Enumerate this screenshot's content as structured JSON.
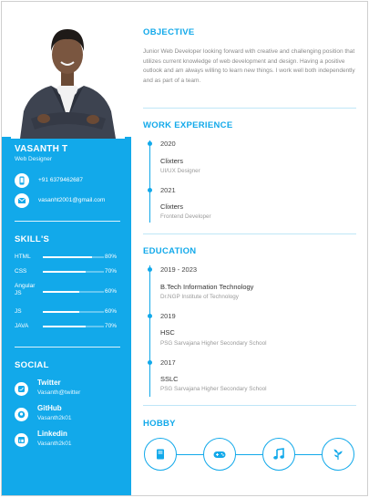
{
  "profile": {
    "name": "VASANTH T",
    "title": "Web Designer",
    "phone": "+91 6379462687",
    "email": "vasanht2001@gmail.com"
  },
  "skills_heading": "SKILL'S",
  "skills": [
    {
      "name": "HTML",
      "percent_label": "80%",
      "level": 0.8
    },
    {
      "name": "CSS",
      "percent_label": "70%",
      "level": 0.7
    },
    {
      "name": "Angular JS",
      "percent_label": "60%",
      "level": 0.6
    },
    {
      "name": "JS",
      "percent_label": "60%",
      "level": 0.6
    },
    {
      "name": "JAVA",
      "percent_label": "70%",
      "level": 0.7
    }
  ],
  "social_heading": "SOCIAL",
  "social": [
    {
      "network": "Twitter",
      "handle": "Vasanth@twitter",
      "icon": "twitter-icon"
    },
    {
      "network": "GitHub",
      "handle": "Vasanth2k01",
      "icon": "github-icon"
    },
    {
      "network": "Linkedin",
      "handle": "Vasanth2k01",
      "icon": "linkedin-icon"
    }
  ],
  "objective": {
    "heading": "OBJECTIVE",
    "text": "Junior Web Developer looking forward with creative and challenging position that utilizes current knowledge of web development and design. Having a positive outlook and am always willing to learn new things. I work well both independently and as part of a team."
  },
  "work": {
    "heading": "WORK EXPERIENCE",
    "items": [
      {
        "year": "2020",
        "company": "Clixters",
        "role": "UI/UX Designer"
      },
      {
        "year": "2021",
        "company": "Clixters",
        "role": "Frontend Developer"
      }
    ]
  },
  "education": {
    "heading": "EDUCATION",
    "items": [
      {
        "year": "2019 - 2023",
        "degree": "B.Tech Information Technology",
        "school": "Dr.NGP Institute of Technology"
      },
      {
        "year": "2019",
        "degree": "HSC",
        "school": "PSG Sarvajana Higher Secondary School"
      },
      {
        "year": "2017",
        "degree": "SSLC",
        "school": "PSG Sarvajana Higher Secondary School"
      }
    ]
  },
  "hobby": {
    "heading": "HOBBY",
    "icons": [
      "book-icon",
      "gamepad-icon",
      "music-icon",
      "plant-icon"
    ]
  },
  "colors": {
    "accent": "#12a9ea",
    "muted": "#8a8a8a"
  }
}
